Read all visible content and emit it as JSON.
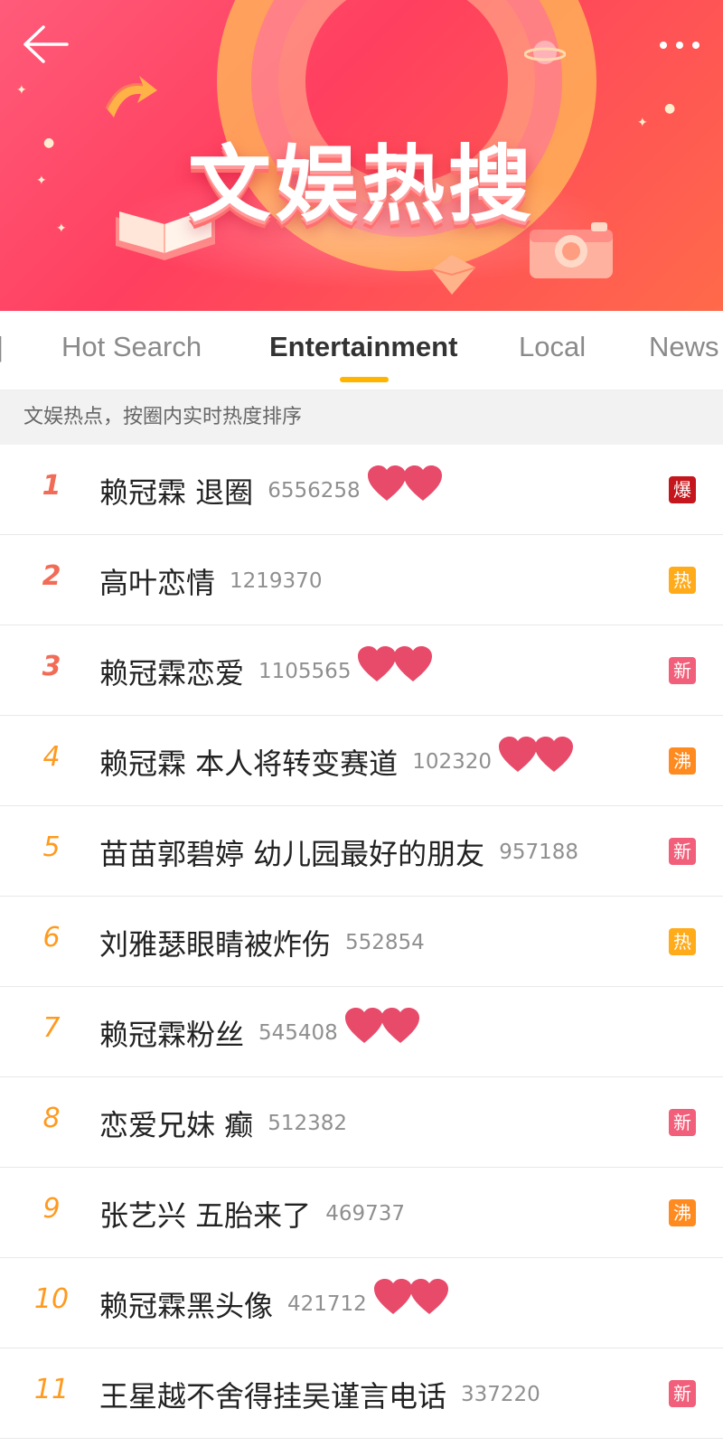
{
  "header": {
    "title": "文娱热搜",
    "icons": {
      "back": "back-arrow-icon",
      "more": "more-dots-icon"
    }
  },
  "tabs": [
    {
      "label": "Hot Search",
      "active": false
    },
    {
      "label": "Entertainment",
      "active": true
    },
    {
      "label": "Local",
      "active": false
    },
    {
      "label": "News",
      "active": false
    }
  ],
  "subheader": "文娱热点，按圈内实时热度排序",
  "colors": {
    "rank_top": "#f26b57",
    "rank_rest": "#ff9a1f",
    "tab_indicator": "#ffb400",
    "badge_bao": "#c4161c",
    "badge_re": "#ffab1a",
    "badge_xin": "#f15f7a",
    "badge_fei": "#ff8a1f",
    "heart": "#e84a6a"
  },
  "items": [
    {
      "rank": "1",
      "topic": "赖冠霖 退圈",
      "count": "6556258",
      "badge": "爆",
      "badge_type": "bao",
      "hearts": true
    },
    {
      "rank": "2",
      "topic": "高叶恋情",
      "count": "1219370",
      "badge": "热",
      "badge_type": "re",
      "hearts": false
    },
    {
      "rank": "3",
      "topic": "赖冠霖恋爱",
      "count": "1105565",
      "badge": "新",
      "badge_type": "xin",
      "hearts": true
    },
    {
      "rank": "4",
      "topic": "赖冠霖 本人将转变赛道",
      "count": "102320",
      "badge": "沸",
      "badge_type": "fei",
      "hearts": true
    },
    {
      "rank": "5",
      "topic": "苗苗郭碧婷 幼儿园最好的朋友",
      "count": "957188",
      "badge": "新",
      "badge_type": "xin",
      "hearts": false
    },
    {
      "rank": "6",
      "topic": "刘雅瑟眼睛被炸伤",
      "count": "552854",
      "badge": "热",
      "badge_type": "re",
      "hearts": false
    },
    {
      "rank": "7",
      "topic": "赖冠霖粉丝",
      "count": "545408",
      "badge": "",
      "badge_type": "",
      "hearts": true
    },
    {
      "rank": "8",
      "topic": "恋爱兄妹 癫",
      "count": "512382",
      "badge": "新",
      "badge_type": "xin",
      "hearts": false
    },
    {
      "rank": "9",
      "topic": "张艺兴 五胎来了",
      "count": "469737",
      "badge": "沸",
      "badge_type": "fei",
      "hearts": false
    },
    {
      "rank": "10",
      "topic": "赖冠霖黑头像",
      "count": "421712",
      "badge": "",
      "badge_type": "",
      "hearts": true
    },
    {
      "rank": "11",
      "topic": "王星越不舍得挂吴谨言电话",
      "count": "337220",
      "badge": "新",
      "badge_type": "xin",
      "hearts": false
    }
  ]
}
